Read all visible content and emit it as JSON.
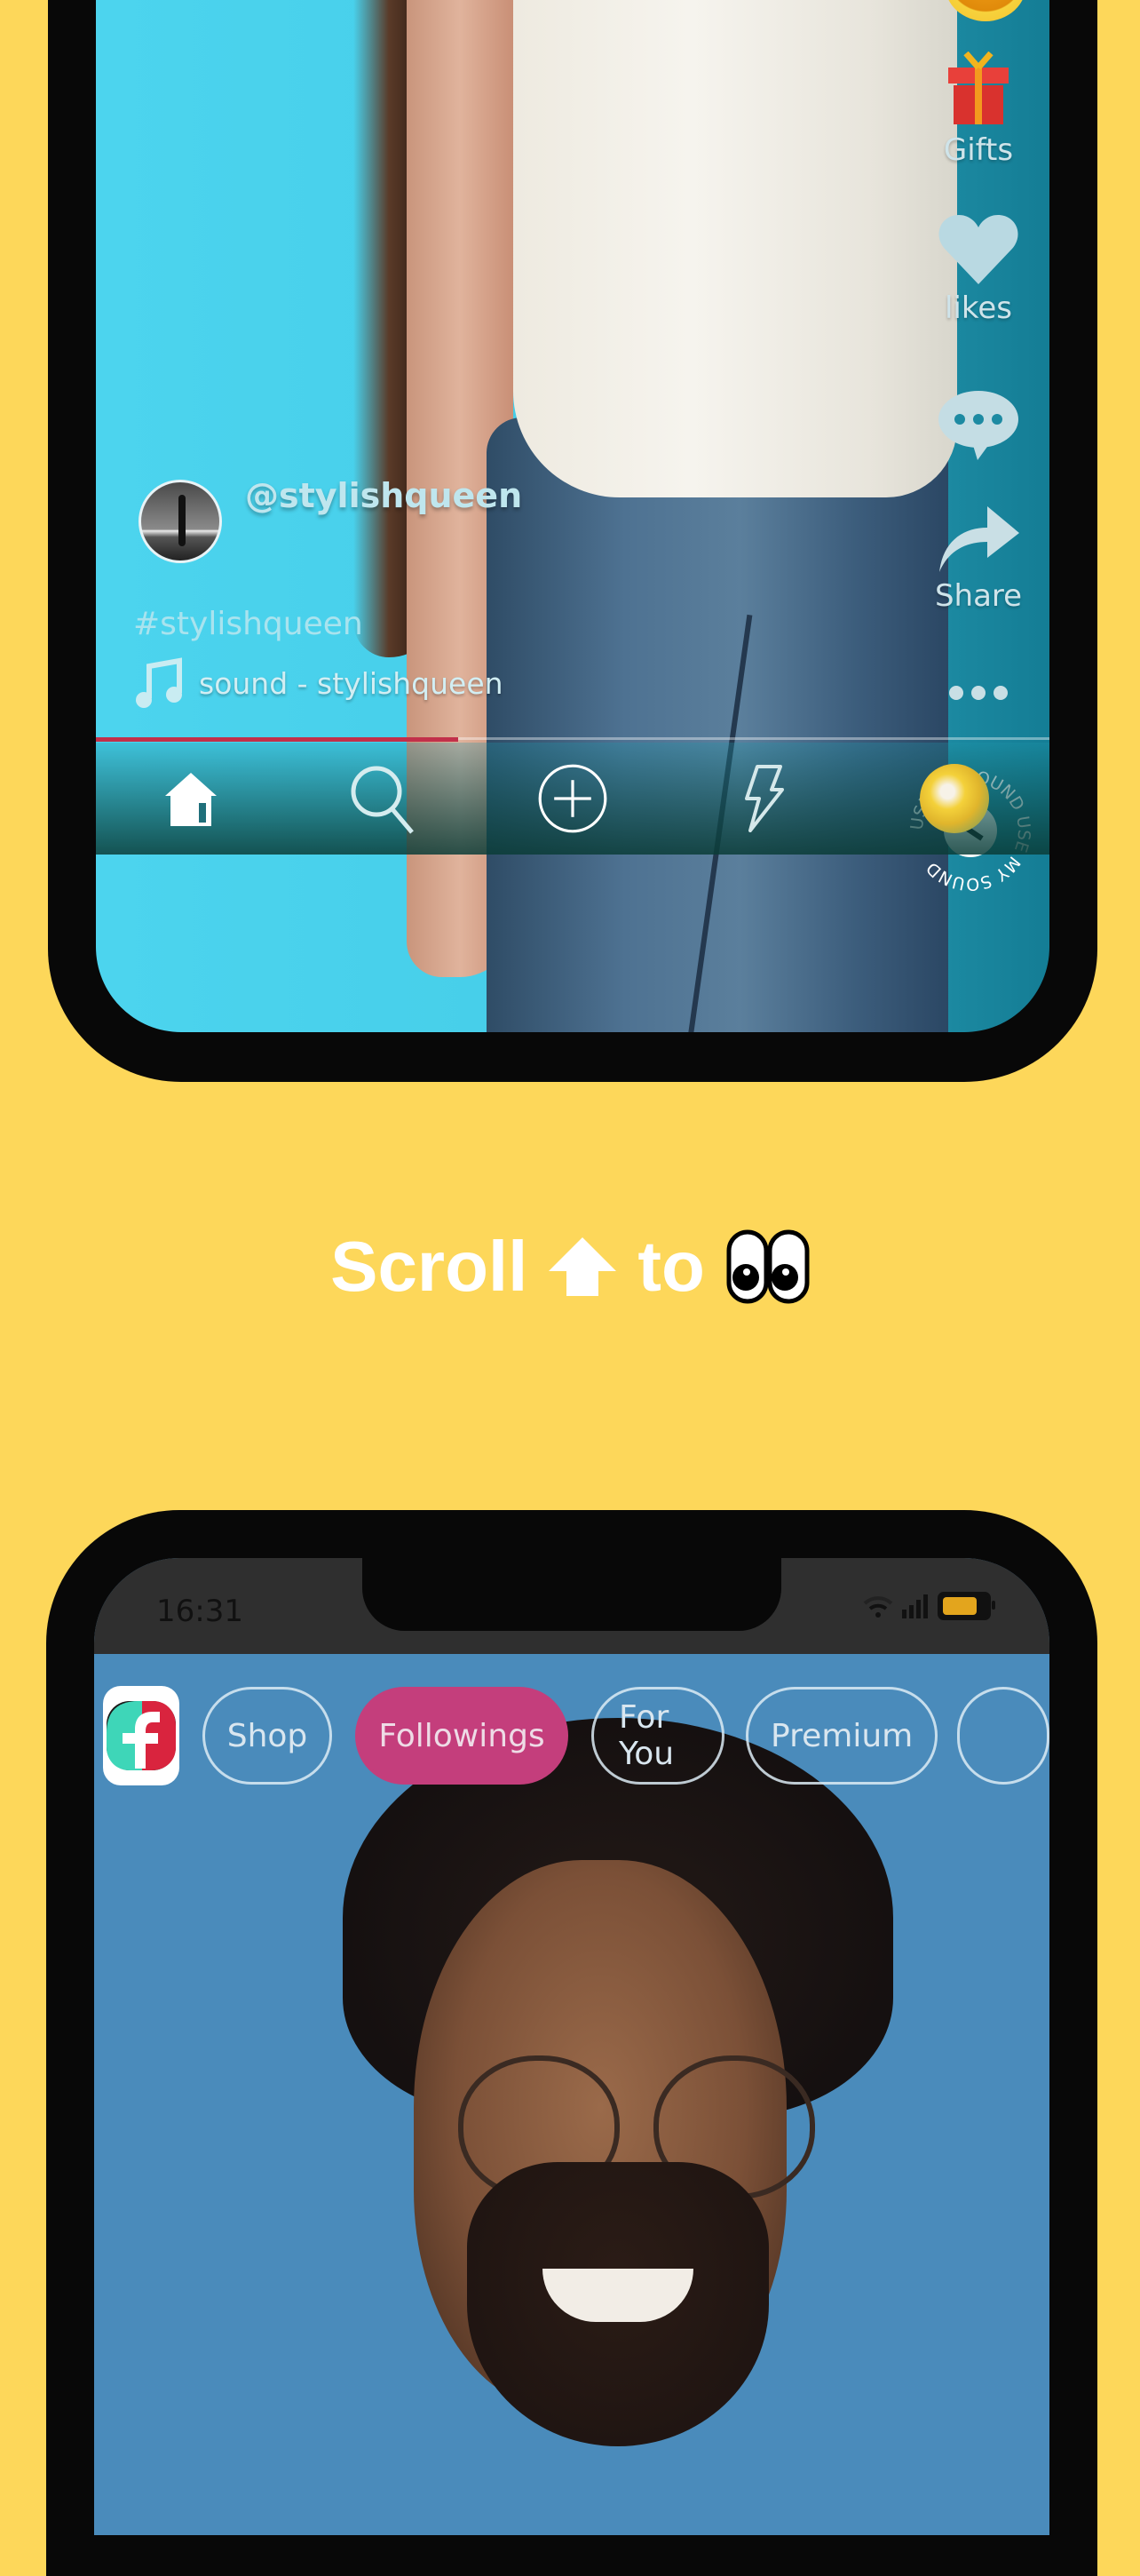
{
  "phone1": {
    "rail": {
      "gifts_label": "Gifts",
      "likes_label": "likes",
      "share_label": "Share",
      "sound_badge_text": "USE MY SOUND"
    },
    "post": {
      "username": "@stylishqueen",
      "hashtag": "#stylishqueen",
      "sound": "sound - stylishqueen",
      "progress_percent": 38
    },
    "nav": {
      "items": [
        "home",
        "search",
        "create",
        "flash",
        "profile"
      ]
    },
    "colors": {
      "progress": "#C2304A",
      "gift_red": "#D9322E",
      "gift_ribbon": "#F39A1E"
    }
  },
  "caption": {
    "text_before": "Scroll",
    "text_after": "to",
    "arrow_icon": "up-arrow",
    "eyes_icon": "eyes-emoji"
  },
  "phone2": {
    "status": {
      "time": "16:31",
      "battery_color": "#E3A51D"
    },
    "tabs": [
      {
        "label": "Shop",
        "active": false
      },
      {
        "label": "Followings",
        "active": true
      },
      {
        "label": "For You",
        "active": false
      },
      {
        "label": "Premium",
        "active": false
      }
    ],
    "colors": {
      "active_tab": "#C43E7C",
      "background": "#4A8BBB"
    }
  },
  "page": {
    "background": "#FDD75A"
  }
}
